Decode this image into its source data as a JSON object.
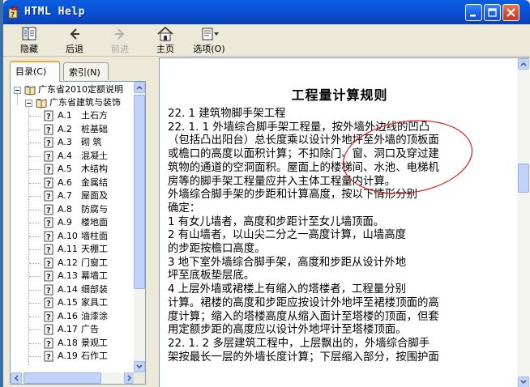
{
  "window": {
    "title": "HTML Help"
  },
  "toolbar": {
    "hide_label": "隐藏",
    "back_label": "后退",
    "forward_label": "前进",
    "home_label": "主页",
    "options_label": "选项(O)"
  },
  "tabs": {
    "contents": "目录(C)",
    "index": "索引(N)"
  },
  "tree": {
    "root": "广东省2010定额说明",
    "folder": "广东省建筑与装饰",
    "items": [
      {
        "code": "A.1",
        "name": "土石方"
      },
      {
        "code": "A.2",
        "name": "桩基础"
      },
      {
        "code": "A.3",
        "name": "砌  筑"
      },
      {
        "code": "A.4",
        "name": "混凝土"
      },
      {
        "code": "A.5",
        "name": "木结构"
      },
      {
        "code": "A.6",
        "name": "金属结"
      },
      {
        "code": "A.7",
        "name": "屋面及"
      },
      {
        "code": "A.8",
        "name": "防腐与"
      },
      {
        "code": "A.9",
        "name": "楼地面"
      },
      {
        "code": "A.10",
        "name": "墙柱面"
      },
      {
        "code": "A.11",
        "name": "天棚工"
      },
      {
        "code": "A.12",
        "name": "门窗工"
      },
      {
        "code": "A.13",
        "name": "幕墙工"
      },
      {
        "code": "A.14",
        "name": "细部装"
      },
      {
        "code": "A.15",
        "name": "家具工"
      },
      {
        "code": "A.16",
        "name": "油漆涂"
      },
      {
        "code": "A.17",
        "name": "广告"
      },
      {
        "code": "A.18",
        "name": "景观工"
      },
      {
        "code": "A.19",
        "name": "石作工"
      }
    ]
  },
  "doc": {
    "title": "工程量计算规则",
    "lines": [
      "22. 1  建筑物脚手架工程",
      "22. 1. 1  外墙综合脚手架工程量，按外墙外边线的凹凸",
      "（包括凸出阳台）总长度乘以设计外地坪至外墙的顶板面",
      "或檐口的高度以面积计算；不扣除门、窗、洞口及穿过建",
      "筑物的通道的空洞面积。屋面上的楼梯间、水池、电梯机",
      "房等的脚手架工程量应并入主体工程量内计算。",
      "    外墙综合脚手架的步距和计算高度，按以下情形分别",
      "确定：",
      "    1  有女儿墙者，高度和步距计至女儿墙顶面。",
      "    2  有山墙者，以山尖二分之一高度计算，山墙高度",
      "的步距按檐口高度。",
      "    3  地下室外墙综合脚手架，高度和步距从设计外地",
      "坪至底板垫层底。",
      "    4  上层外墙或裙楼上有缩入的塔楼者，工程量分别",
      "计算。裙楼的高度和步距应按设计外地坪至裙楼顶面的高",
      "度计算；缩入的塔楼高度从缩入面计至塔楼的顶面，但套",
      "用定额步距的高度应以设计外地坪计至塔楼顶面。",
      "22. 1. 2  多层建筑工程中，上层飘出的，外墙综合脚手",
      "架按最长一层的外墙长度计算；下层缩入部分，按围护面"
    ]
  }
}
